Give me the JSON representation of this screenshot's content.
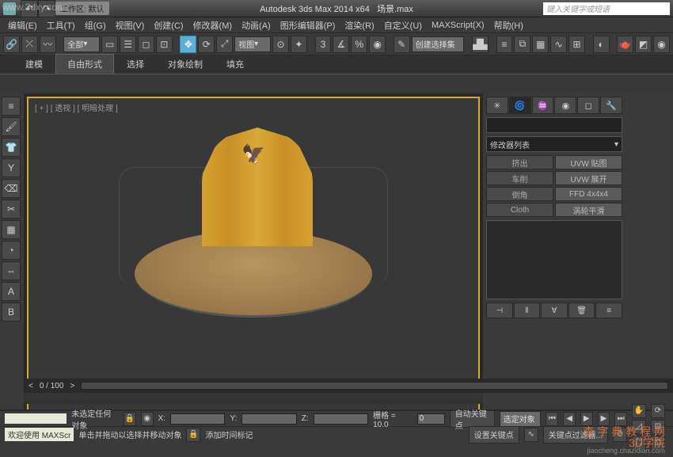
{
  "titlebar": {
    "workspace_label": "工作区: 默认",
    "app_title": "Autodesk 3ds Max  2014 x64",
    "file_name": "场景.max",
    "search_placeholder": "键入关键字或短语"
  },
  "menu": [
    "编辑(E)",
    "工具(T)",
    "组(G)",
    "视图(V)",
    "创建(C)",
    "修改器(M)",
    "动画(A)",
    "图形编辑器(P)",
    "渲染(R)",
    "自定义(U)",
    "MAXScript(X)",
    "帮助(H)"
  ],
  "toolbar1": {
    "selection_set_dropdown": "全部",
    "view_dropdown": "视图",
    "create_selection": "创建选择集"
  },
  "ribbon_tabs": [
    "建模",
    "自由形式",
    "选择",
    "对象绘制",
    "填充"
  ],
  "active_ribbon_tab": 1,
  "viewport": {
    "labels": "[ + ] [ 透视 ] [ 明暗处理 ]"
  },
  "command_panel": {
    "modifier_list_label": "修改器列表",
    "buttons": [
      {
        "l": "挤出",
        "r": "UVW 贴图"
      },
      {
        "l": "车削",
        "r": "UVW 展开"
      },
      {
        "l": "倒角",
        "r": "FFD 4x4x4"
      },
      {
        "l": "Cloth",
        "r": "涡轮平滑"
      }
    ]
  },
  "timeline": {
    "current": "0",
    "range": "0 / 100"
  },
  "status": {
    "selection_msg": "未选定任何对象",
    "hint_msg": "单击并拖动以选择并移动对象",
    "lock_label": "添加时间标记",
    "x_label": "X:",
    "y_label": "Y:",
    "z_label": "Z:",
    "grid_label": "栅格 = 10.0",
    "frame_spinner": "0",
    "autokey": "自动关键点",
    "setkey": "设置关键点",
    "sel_obj": "选定对象",
    "key_filter": "关键点过滤器...",
    "welcome": "欢迎使用  MAXScr"
  },
  "watermarks": {
    "tl": "www.3dxy.com",
    "br_logo": "3D学院",
    "br_sub1": "查  字  典  教  程  网",
    "br_sub2": "jiaocheng.chazidian.com"
  }
}
